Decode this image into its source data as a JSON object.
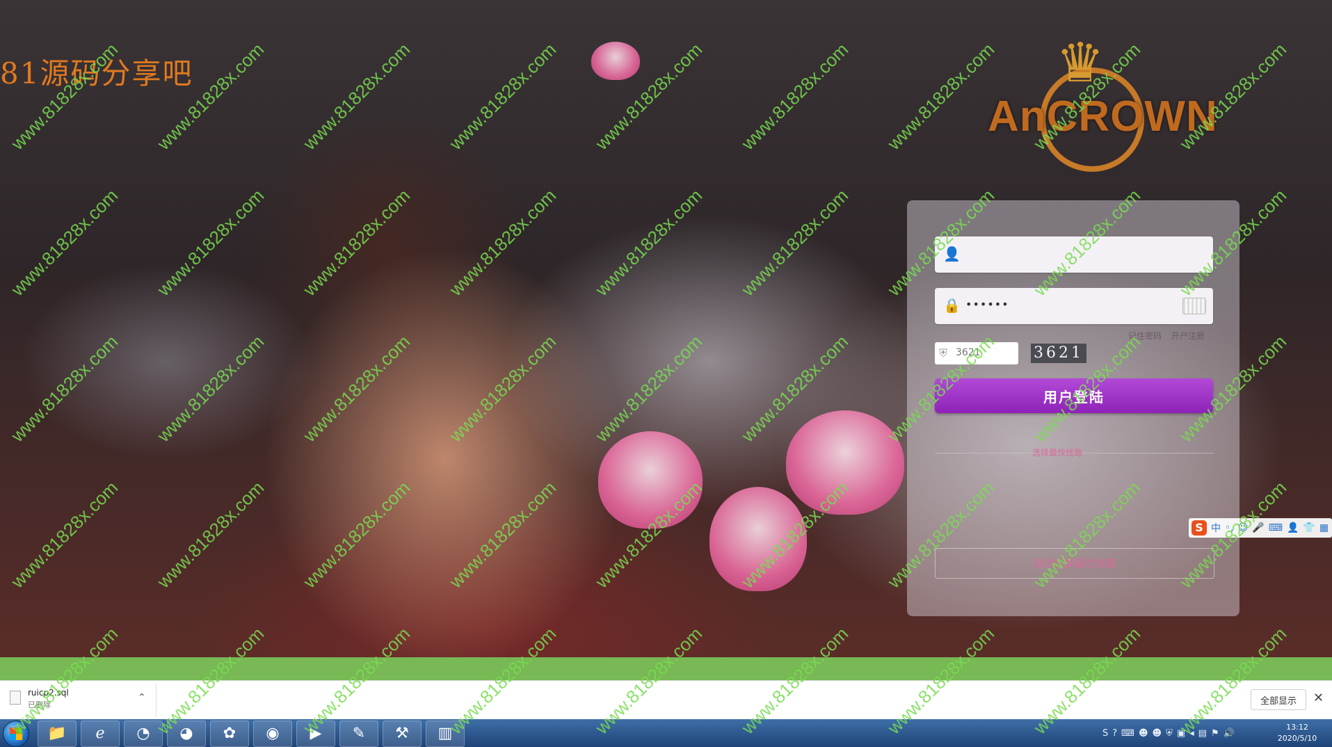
{
  "site_brand": "81源码分享吧",
  "logo_text": "AnCROWN",
  "watermark_text": "www.81828x.com",
  "login": {
    "password_value": "••••••",
    "remember_label": "记住密码",
    "register_label": "开户注册",
    "captcha_value": "3621",
    "captcha_image_text": "3621",
    "login_button": "用户登陆",
    "divider_text": "选择最快线路",
    "route_button": "自动切换最优线路"
  },
  "download_bar": {
    "file_name": "ruicp2.sql",
    "file_status": "已删除",
    "show_all": "全部显示"
  },
  "taskbar": {
    "apps": [
      "folder-icon",
      "ie-icon",
      "chrome-alt-icon",
      "firefox-icon",
      "network-icon",
      "chrome-icon",
      "media-player-icon",
      "editor-icon",
      "tool-icon",
      "chart-app-icon"
    ],
    "time": "13:12",
    "date": "2020/5/10"
  },
  "colors": {
    "accent": "#9a2fc6",
    "green_band": "#78b855",
    "brand_text": "#e07a20"
  }
}
